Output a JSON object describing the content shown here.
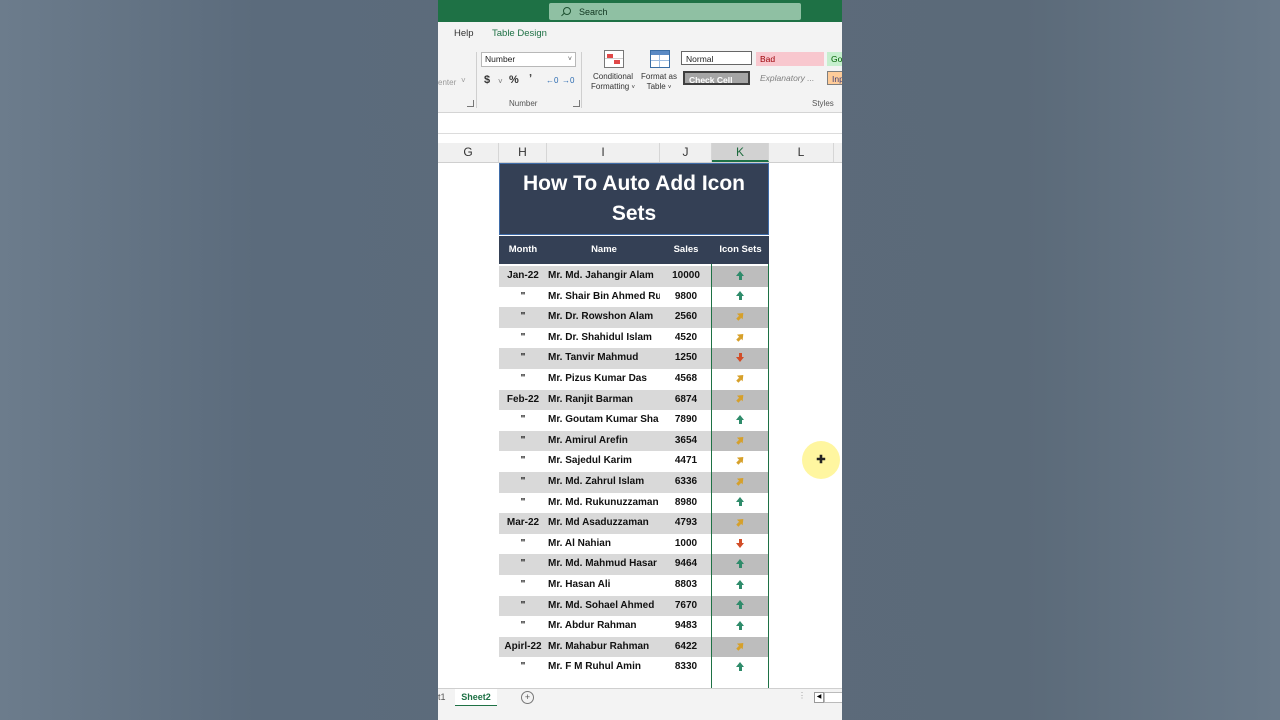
{
  "search": {
    "placeholder": "Search"
  },
  "ribbon": {
    "tabs": [
      "Help",
      "Table Design"
    ],
    "number_format": "Number",
    "alignment_partial": "enter",
    "currency_symbol": "$",
    "percent_symbol": "%",
    "comma_symbol": "ʼ",
    "number_group_label": "Number",
    "conditional_formatting": [
      "Conditional",
      "Formatting"
    ],
    "format_as_table": [
      "Format as",
      "Table"
    ],
    "styles": {
      "normal": "Normal",
      "bad": "Bad",
      "good": "Go",
      "check_cell": "Check Cell",
      "explanatory": "Explanatory ...",
      "input": "Inp",
      "group_label": "Styles"
    }
  },
  "columns": [
    "G",
    "H",
    "I",
    "J",
    "K",
    "L"
  ],
  "table": {
    "title": "How To Auto Add Icon Sets",
    "headers": [
      "Month",
      "Name",
      "Sales",
      "Icon Sets"
    ],
    "rows": [
      {
        "month": "Jan-22",
        "name": "Mr. Md. Jahangir Alam",
        "sales": "10000",
        "icon": "up"
      },
      {
        "month": "\"",
        "name": "Mr. Shair Bin Ahmed Ru",
        "sales": "9800",
        "icon": "up"
      },
      {
        "month": "\"",
        "name": "Mr. Dr. Rowshon Alam",
        "sales": "2560",
        "icon": "side"
      },
      {
        "month": "\"",
        "name": "Mr. Dr. Shahidul Islam",
        "sales": "4520",
        "icon": "side"
      },
      {
        "month": "\"",
        "name": "Mr. Tanvir Mahmud",
        "sales": "1250",
        "icon": "down"
      },
      {
        "month": "\"",
        "name": "Mr. Pizus Kumar Das",
        "sales": "4568",
        "icon": "side"
      },
      {
        "month": "Feb-22",
        "name": "Mr. Ranjit Barman",
        "sales": "6874",
        "icon": "side"
      },
      {
        "month": "\"",
        "name": "Mr. Goutam Kumar Sha",
        "sales": "7890",
        "icon": "up"
      },
      {
        "month": "\"",
        "name": "Mr. Amirul Arefin",
        "sales": "3654",
        "icon": "side"
      },
      {
        "month": "\"",
        "name": "Mr. Sajedul Karim",
        "sales": "4471",
        "icon": "side"
      },
      {
        "month": "\"",
        "name": "Mr. Md. Zahrul Islam",
        "sales": "6336",
        "icon": "side"
      },
      {
        "month": "\"",
        "name": "Mr. Md. Rukunuzzaman",
        "sales": "8980",
        "icon": "up"
      },
      {
        "month": "Mar-22",
        "name": "Mr. Md Asaduzzaman",
        "sales": "4793",
        "icon": "side"
      },
      {
        "month": "\"",
        "name": "Mr. Al Nahian",
        "sales": "1000",
        "icon": "down"
      },
      {
        "month": "\"",
        "name": "Mr. Md. Mahmud Hasar",
        "sales": "9464",
        "icon": "up"
      },
      {
        "month": "\"",
        "name": "Mr. Hasan Ali",
        "sales": "8803",
        "icon": "up"
      },
      {
        "month": "\"",
        "name": "Mr. Md. Sohael Ahmed",
        "sales": "7670",
        "icon": "up"
      },
      {
        "month": "\"",
        "name": "Mr. Abdur Rahman",
        "sales": "9483",
        "icon": "up"
      },
      {
        "month": "Apirl-22",
        "name": "Mr. Mahabur Rahman",
        "sales": "6422",
        "icon": "side"
      },
      {
        "month": "\"",
        "name": "Mr. F M Ruhul Amin",
        "sales": "8330",
        "icon": "up"
      }
    ]
  },
  "sheet_tabs": {
    "partial": "t1",
    "active": "Sheet2"
  },
  "icon_colors": {
    "up": "#2e8b6a",
    "side": "#d6a02a",
    "down": "#d24d28",
    "accent": "#1e7145"
  }
}
